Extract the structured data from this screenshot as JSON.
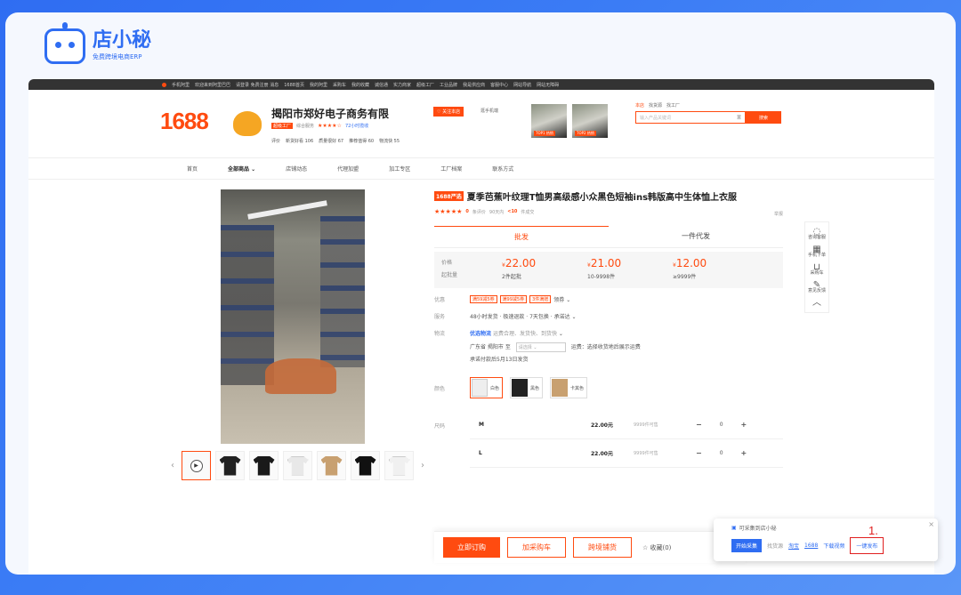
{
  "brand": {
    "name": "店小秘",
    "sub": "免费跨境电商ERP"
  },
  "topbar": {
    "items": [
      "手机阿里",
      "欢迎来到阿里巴巴",
      "请登录 免费注册 消息",
      "1688首页",
      "我的阿里",
      "采购车",
      "我的收藏",
      "诚信通",
      "实力商家",
      "超级工厂",
      "工业品牌",
      "我是供应商",
      "客服中心",
      "网站导航",
      "网站无障碍"
    ]
  },
  "shop": {
    "logo": "1688",
    "name": "揭阳市郑好电子商务有限",
    "level": "超级工厂",
    "service": "综合服务",
    "stars": "★★★★☆",
    "response": "72小时揽收",
    "stats": [
      "评价",
      "新货好看 106",
      "质量很好 67",
      "推荐值得 60",
      "物流快 55"
    ],
    "follow": "♡ 关注本店",
    "phone": "逛手机端",
    "img_tags": [
      "TOP1 热销",
      "TOP2 热销"
    ]
  },
  "search": {
    "tabs": [
      "本店",
      "找货源",
      "找工厂"
    ],
    "placeholder": "输入产品关键词",
    "button": "搜索"
  },
  "nav": {
    "items": [
      "首页",
      "全部商品",
      "店铺动态",
      "代理加盟",
      "加工专区",
      "工厂档案",
      "联系方式"
    ]
  },
  "product": {
    "badge": "1688严选",
    "title": "夏季芭蕉叶纹理T恤男高级感小众黑色短袖ins韩版高中生体恤上衣服",
    "rating_count": "0",
    "rating_text": "条评价",
    "sales_prefix": "90天内",
    "sales": "<10",
    "sales_suffix": "件成交",
    "report": "举报",
    "tabs": [
      "批发",
      "一件代发"
    ],
    "price_labels": [
      "价格",
      "起批量"
    ],
    "prices": [
      {
        "price": "22.00",
        "qty": "2件起批"
      },
      {
        "price": "21.00",
        "qty": "10-9998件"
      },
      {
        "price": "12.00",
        "qty": "≥9999件"
      }
    ],
    "promo_label": "优惠",
    "coupons": [
      "满59减5券",
      "满99减5券",
      "3件满赠"
    ],
    "coupon_link": "领券",
    "service_label": "服务",
    "service_text": "48小时发货 · 极速退款 · 7天包换 · 承诺达",
    "logistics_label": "物流",
    "logistics_brand": "优选物流",
    "logistics_desc": "运费合理、发货快、到货快",
    "ship_from": "广东省 揭阳市",
    "ship_to_label": "至",
    "ship_select": "请选择",
    "freight": "运费：选择收货地后展示运费",
    "ship_time": "承诺付款后5月13日发货",
    "color_label": "颜色",
    "colors": [
      "白色",
      "黑色",
      "卡其色"
    ],
    "size_label": "尺码",
    "sizes": [
      {
        "name": "M",
        "price": "22.00元",
        "stock": "9999件可售",
        "qty": "0"
      },
      {
        "name": "L",
        "price": "22.00元",
        "stock": "9999件可售",
        "qty": "0"
      }
    ]
  },
  "actions": {
    "order": "立即订购",
    "cart": "加采购车",
    "cross": "跨境铺货",
    "fav": "☆ 收藏(0)"
  },
  "side": [
    {
      "icon": "◌",
      "label": "咨询客服"
    },
    {
      "icon": "▦",
      "label": "手机下单"
    },
    {
      "icon": "⊔",
      "label": "采购车"
    },
    {
      "icon": "✎",
      "label": "意见反馈"
    },
    {
      "icon": "︿",
      "label": ""
    }
  ],
  "popup": {
    "title": "可采集到店小秘",
    "collect": "开始采集",
    "source_label": "找货源",
    "links": [
      "淘宝",
      "1688"
    ],
    "download": "下载视频",
    "publish": "一键发布",
    "close": "×"
  },
  "step": "1."
}
